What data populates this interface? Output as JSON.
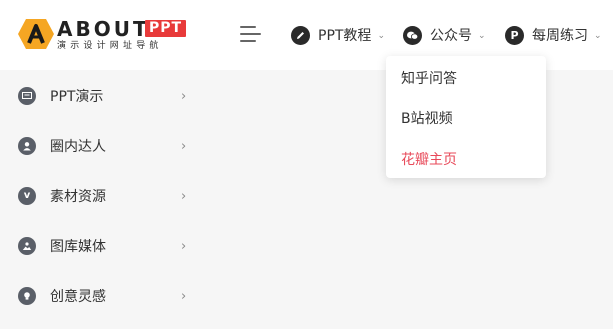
{
  "logo": {
    "word": "ABOUT",
    "badge": "PPT",
    "subtitle": "演示设计网址导航",
    "accent": "#f5a623"
  },
  "header": {
    "menu_icon": "hamburger-icon",
    "nav": [
      {
        "label": "PPT教程",
        "icon": "pencil-icon"
      },
      {
        "label": "公众号",
        "icon": "wechat-icon"
      },
      {
        "label": "每周练习",
        "icon": "p-badge-icon"
      }
    ]
  },
  "dropdown": {
    "items": [
      {
        "label": "知乎问答"
      },
      {
        "label": "B站视频"
      },
      {
        "label": "花瓣主页",
        "color": "#e84a5a"
      }
    ]
  },
  "sidebar": {
    "items": [
      {
        "label": "PPT演示",
        "icon": "slides-icon"
      },
      {
        "label": "圈内达人",
        "icon": "user-icon"
      },
      {
        "label": "素材资源",
        "icon": "v-icon"
      },
      {
        "label": "图库媒体",
        "icon": "image-icon"
      },
      {
        "label": "创意灵感",
        "icon": "bulb-icon"
      }
    ]
  },
  "colors": {
    "header_bg": "#ffffff",
    "page_bg": "#f6f6f6",
    "brand_red": "#e83a3a",
    "highlight": "#e84a5a"
  }
}
